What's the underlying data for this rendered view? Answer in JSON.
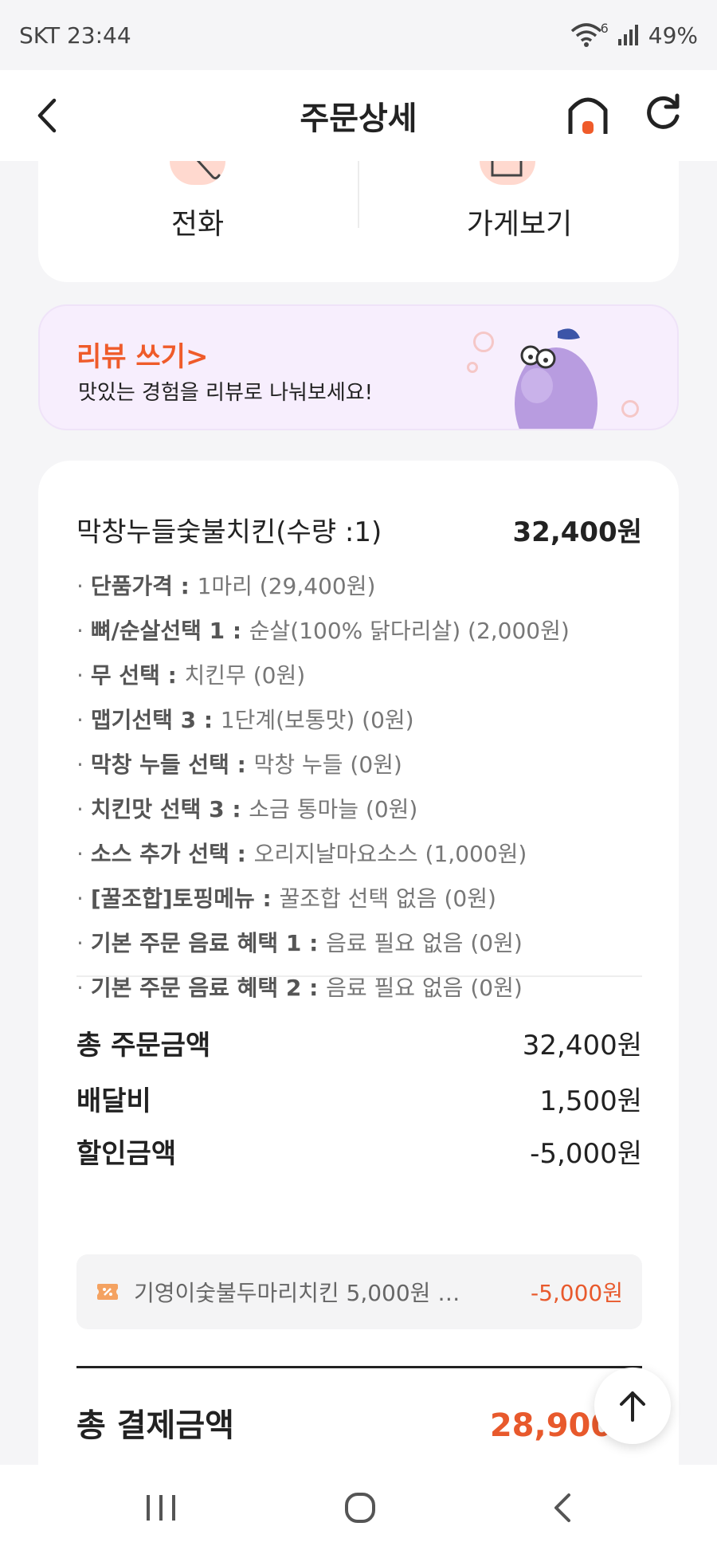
{
  "status_bar": {
    "carrier": "SKT",
    "time": "23:44",
    "wifi_badge": "6",
    "battery": "49%"
  },
  "header": {
    "title": "주문상세"
  },
  "actions": {
    "call_label": "전화",
    "store_label": "가게보기"
  },
  "review_banner": {
    "title": "리뷰 쓰기>",
    "subtitle": "맛있는 경험을 리뷰로 나눠보세요!"
  },
  "order": {
    "item_name": "막창누들숯불치킨(수량 :1)",
    "item_price": "32,400원",
    "options": [
      {
        "label": "단품가격",
        "value": "1마리 (29,400원)"
      },
      {
        "label": "뼈/순살선택 1",
        "value": "순살(100% 닭다리살) (2,000원)"
      },
      {
        "label": "무 선택",
        "value": "치킨무 (0원)"
      },
      {
        "label": "맵기선택 3",
        "value": "1단계(보통맛) (0원)"
      },
      {
        "label": "막창 누들 선택",
        "value": "막창 누들 (0원)"
      },
      {
        "label": "치킨맛 선택 3",
        "value": "소금 통마늘 (0원)"
      },
      {
        "label": "소스 추가 선택",
        "value": "오리지날마요소스 (1,000원)"
      },
      {
        "label": "[꿀조합]토핑메뉴",
        "value": "꿀조합 선택 없음 (0원)"
      },
      {
        "label": "기본 주문 음료 혜택 1",
        "value": "음료 필요 없음 (0원)"
      },
      {
        "label": "기본 주문 음료 혜택 2",
        "value": "음료 필요 없음 (0원)"
      }
    ]
  },
  "summary": {
    "total_order_label": "총 주문금액",
    "total_order_value": "32,400원",
    "delivery_label": "배달비",
    "delivery_value": "1,500원",
    "discount_label": "할인금액",
    "discount_value": "-5,000원",
    "coupon_text": "기영이숯불두마리치킨 5,000원 …",
    "coupon_amount": "-5,000원",
    "total_payment_label": "총 결제금액",
    "total_payment_value": "28,900원"
  },
  "colors": {
    "accent": "#e8592c",
    "banner_bg": "#f7eefd",
    "page_bg": "#f5f5f7"
  },
  "icons": {
    "back": "chevron-left-icon",
    "home": "home-icon",
    "refresh": "refresh-icon",
    "scroll_top": "arrow-up-icon",
    "coupon": "coupon-icon"
  }
}
